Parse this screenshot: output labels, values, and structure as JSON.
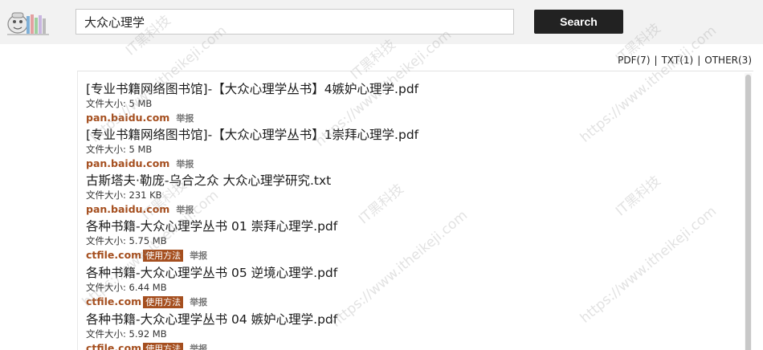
{
  "search": {
    "value": "大众心理学",
    "button_label": "Search"
  },
  "filters": [
    {
      "label": "PDF(7)"
    },
    {
      "label": "TXT(1)"
    },
    {
      "label": "OTHER(3)"
    }
  ],
  "filter_separator": "|",
  "results": [
    {
      "title": "[专业书籍网络图书馆]-【大众心理学丛书】4嫉妒心理学.pdf",
      "size": "文件大小: 5 MB",
      "source": "pan.baidu.com",
      "usage": "",
      "report": "举报"
    },
    {
      "title": "[专业书籍网络图书馆]-【大众心理学丛书】1崇拜心理学.pdf",
      "size": "文件大小: 5 MB",
      "source": "pan.baidu.com",
      "usage": "",
      "report": "举报"
    },
    {
      "title": "古斯塔夫·勒庞-乌合之众 大众心理学研究.txt",
      "size": "文件大小: 231 KB",
      "source": "pan.baidu.com",
      "usage": "",
      "report": "举报"
    },
    {
      "title": "各种书籍-大众心理学丛书 01 崇拜心理学.pdf",
      "size": "文件大小: 5.75 MB",
      "source": "ctfile.com",
      "usage": "使用方法",
      "report": "举报"
    },
    {
      "title": "各种书籍-大众心理学丛书 05 逆境心理学.pdf",
      "size": "文件大小: 6.44 MB",
      "source": "ctfile.com",
      "usage": "使用方法",
      "report": "举报"
    },
    {
      "title": "各种书籍-大众心理学丛书 04 嫉妒心理学.pdf",
      "size": "文件大小: 5.92 MB",
      "source": "ctfile.com",
      "usage": "使用方法",
      "report": "举报"
    }
  ],
  "watermark": {
    "brand": "IT黑科技",
    "url": "https://www.itheikeji.com"
  },
  "colors": {
    "topbar_bg": "#f2f2f2",
    "button_bg": "#222222",
    "source_link": "#a54f1f"
  }
}
